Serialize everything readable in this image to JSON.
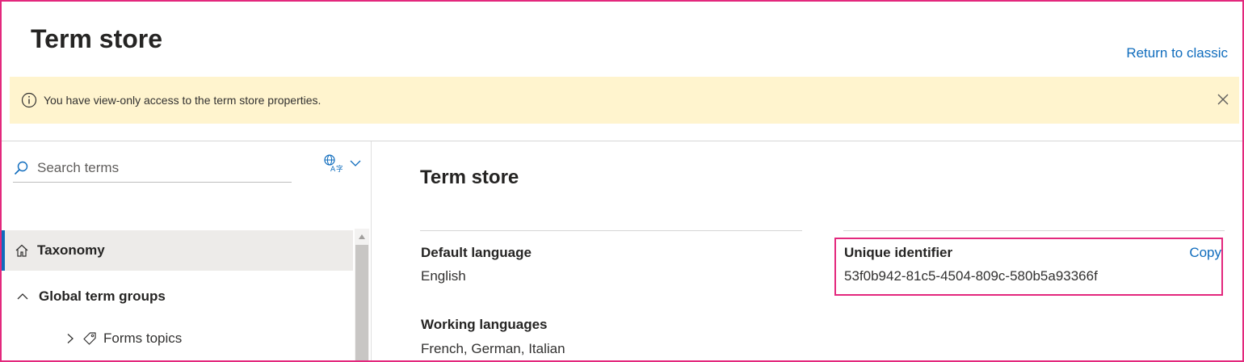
{
  "header": {
    "title": "Term store",
    "return_link": "Return to classic"
  },
  "banner": {
    "message": "You have view-only access to the term store properties.",
    "info_icon": "info-icon",
    "close_icon": "close-icon"
  },
  "sidebar": {
    "search_placeholder": "Search terms",
    "language_icon": "translate-icon",
    "items": [
      {
        "label": "Taxonomy",
        "icon": "home-icon",
        "selected": true
      },
      {
        "label": "Global term groups",
        "icon": "chevron-up-icon",
        "expanded": true
      },
      {
        "label": "Forms topics",
        "icon": "tag-icon"
      }
    ]
  },
  "main": {
    "title": "Term store",
    "default_language": {
      "label": "Default language",
      "value": "English"
    },
    "working_languages": {
      "label": "Working languages",
      "value": "French, German, Italian"
    },
    "unique_identifier": {
      "label": "Unique identifier",
      "value": "53f0b942-81c5-4504-809c-580b5a93366f",
      "copy_label": "Copy"
    }
  },
  "colors": {
    "accent": "#0f6cbd",
    "banner_bg": "#fff4ce",
    "highlight_border": "#e3287d",
    "selected_bg": "#edebe9"
  }
}
